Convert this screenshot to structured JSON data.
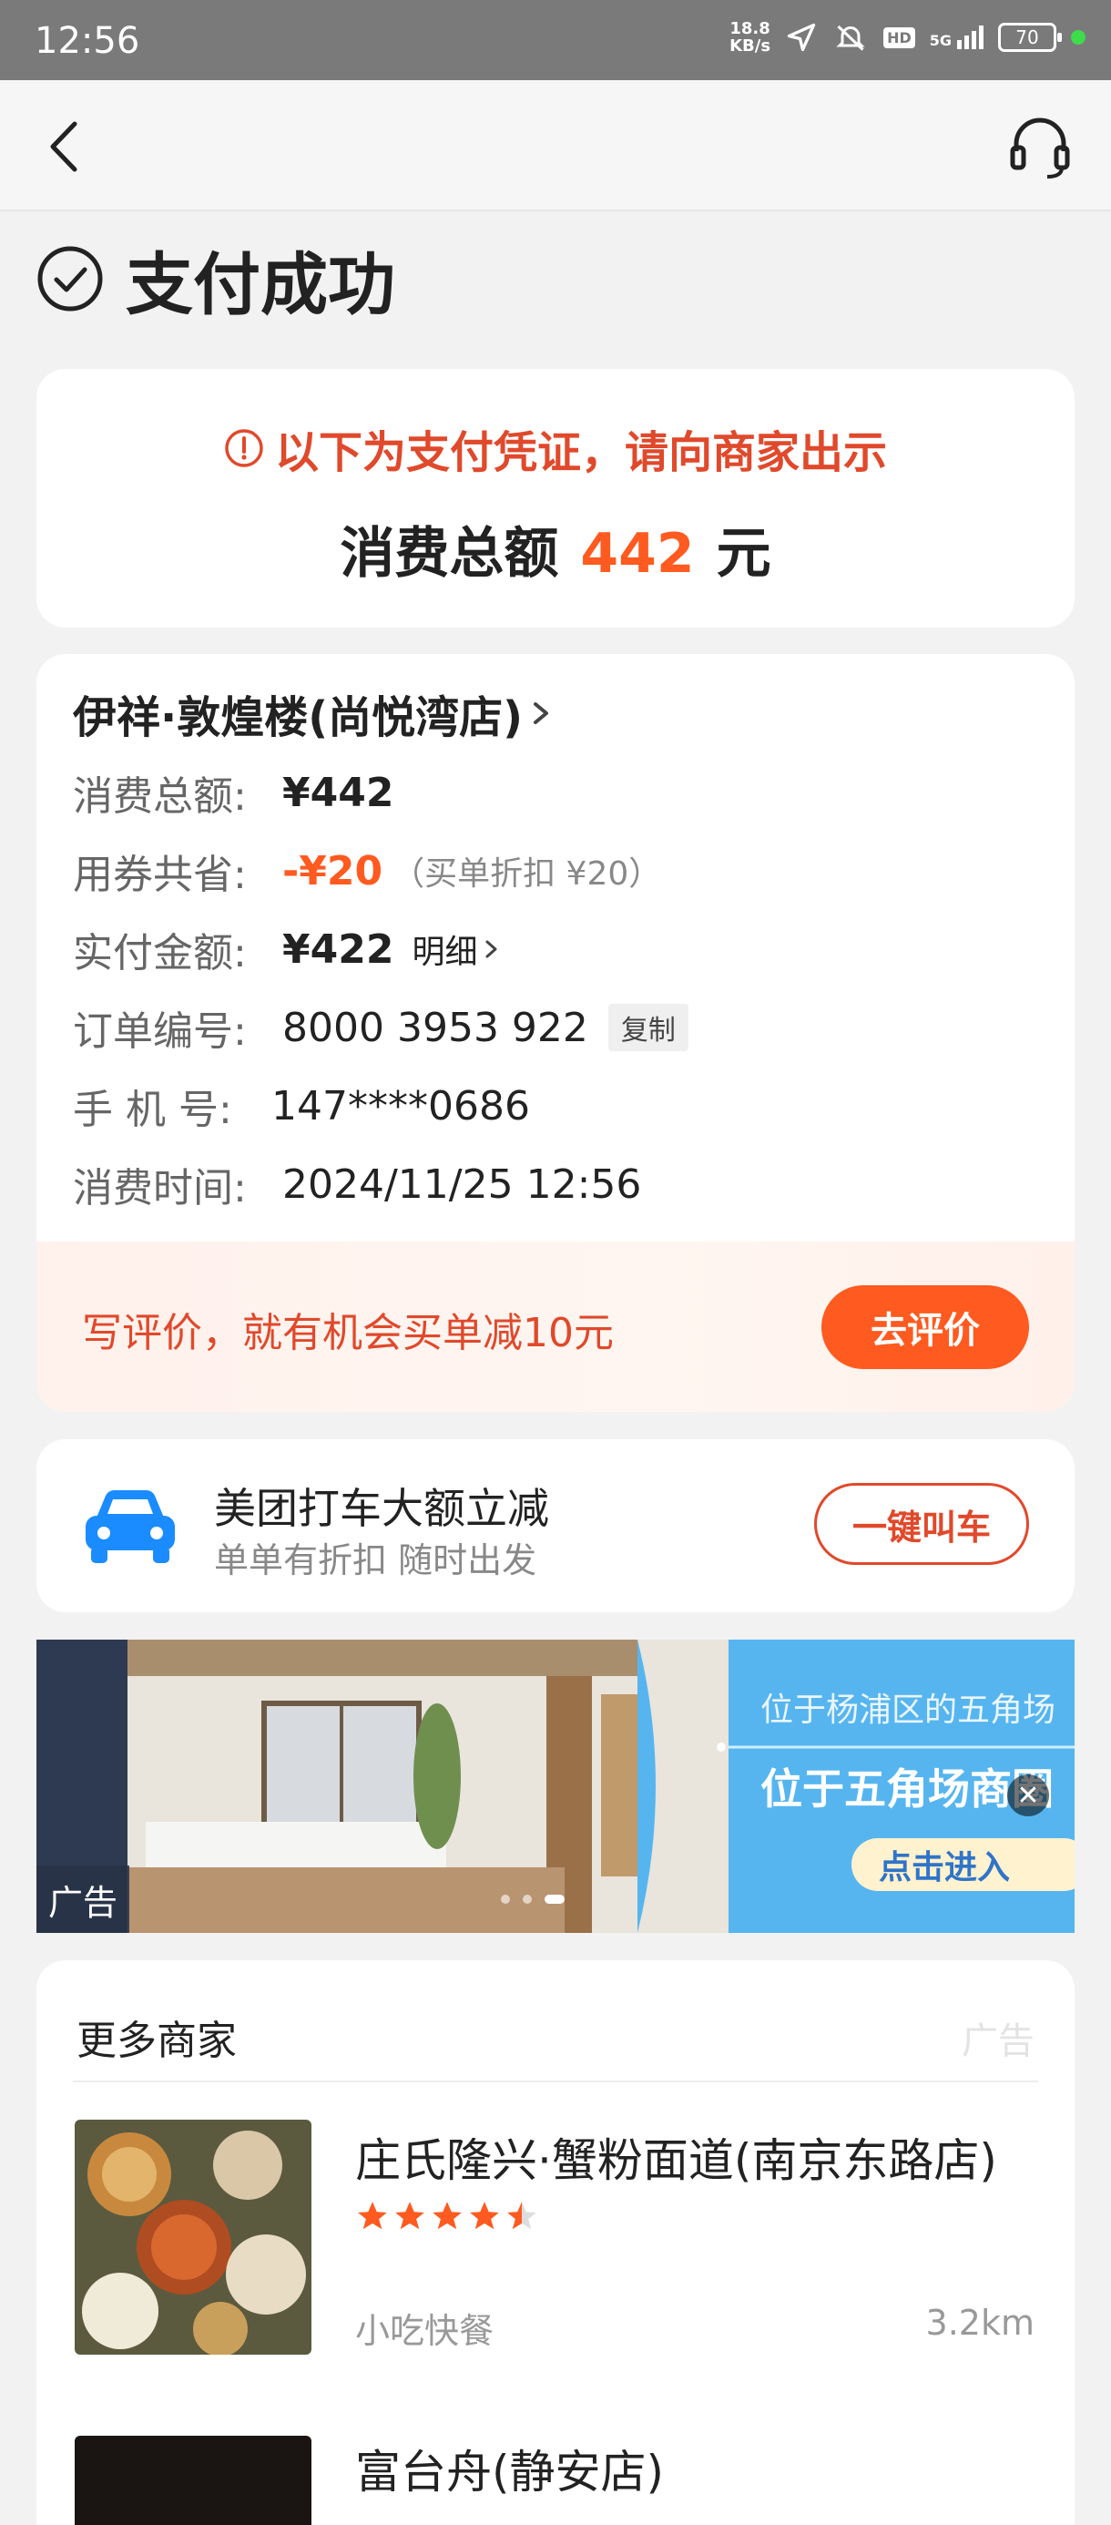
{
  "status_bar": {
    "time": "12:56",
    "net_speed_top": "18.8",
    "net_speed_bottom": "KB/s",
    "hd": "HD",
    "signal": "5G",
    "battery": "70"
  },
  "header": {
    "back_icon": "chevron-left-icon",
    "service_icon": "headset-icon"
  },
  "success": {
    "title": "支付成功",
    "icon": "check-circle-icon"
  },
  "voucher": {
    "notice": "以下为支付凭证，请向商家出示",
    "total_label": "消费总额",
    "total_amount": "442",
    "total_unit": "元"
  },
  "order": {
    "store_name": "伊祥·敦煌楼(尚悦湾店)",
    "rows": [
      {
        "label": "消费总额:",
        "value": "¥442"
      },
      {
        "label": "用券共省:",
        "value": "-¥20",
        "note": "（买单折扣 ¥20）"
      },
      {
        "label": "实付金额:",
        "value": "¥422",
        "extra": "明细"
      },
      {
        "label": "订单编号:",
        "value": "8000 3953 922",
        "extra": "复制"
      },
      {
        "label": "手 机 号:",
        "value": "147****0686"
      },
      {
        "label": "消费时间:",
        "value": "2024/11/25 12:56"
      }
    ],
    "review_text": "写评价，就有机会买单减10元",
    "review_button": "去评价"
  },
  "taxi": {
    "title": "美团打车大额立减",
    "subtitle": "单单有折扣 随时出发",
    "button": "一键叫车",
    "icon": "car-icon"
  },
  "ad_banner": {
    "tag": "广告",
    "line1": "位于杨浦区的五角场",
    "line2": "位于五角场商圈",
    "cta": "点击进入",
    "close_icon": "close-icon"
  },
  "more": {
    "title": "更多商家",
    "ad_label": "广告",
    "merchants": [
      {
        "name": "庄氏隆兴·蟹粉面道(南京东路店)",
        "rating": 4.5,
        "category": "小吃快餐",
        "distance": "3.2km"
      },
      {
        "name": "富台舟(静安店)"
      }
    ]
  },
  "colors": {
    "accent": "#ff5a1f",
    "accent_text": "#e0492b",
    "taxi_blue": "#1a8cff"
  }
}
